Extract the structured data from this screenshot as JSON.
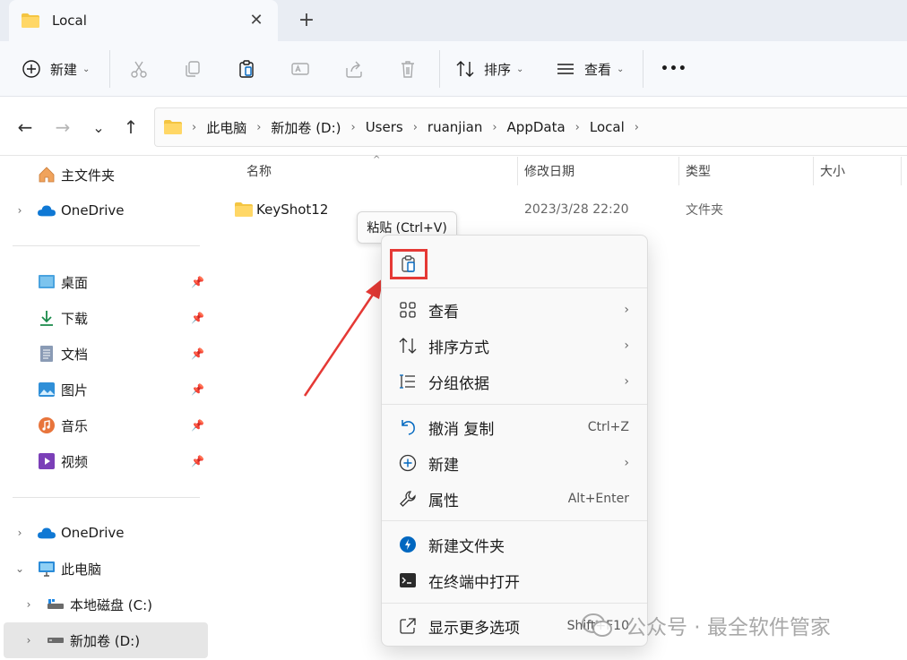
{
  "tab": {
    "title": "Local",
    "close": "✕",
    "new_tab": "+"
  },
  "toolbar": {
    "new_label": "新建",
    "sort_label": "排序",
    "view_label": "查看",
    "more": "•••"
  },
  "breadcrumb": [
    "此电脑",
    "新加卷 (D:)",
    "Users",
    "ruanjian",
    "AppData",
    "Local"
  ],
  "sidebar": {
    "home": "主文件夹",
    "onedrive_top": "OneDrive",
    "quick": [
      {
        "label": "桌面",
        "icon": "desktop-icon"
      },
      {
        "label": "下载",
        "icon": "download-icon"
      },
      {
        "label": "文档",
        "icon": "document-icon"
      },
      {
        "label": "图片",
        "icon": "pictures-icon"
      },
      {
        "label": "音乐",
        "icon": "music-icon"
      },
      {
        "label": "视频",
        "icon": "video-icon"
      }
    ],
    "onedrive": "OneDrive",
    "this_pc": "此电脑",
    "drive_c": "本地磁盘 (C:)",
    "drive_d": "新加卷 (D:)"
  },
  "columns": {
    "name": "名称",
    "date": "修改日期",
    "type": "类型",
    "size": "大小"
  },
  "files": [
    {
      "name": "KeyShot12",
      "date": "2023/3/28 22:20",
      "type": "文件夹"
    }
  ],
  "tooltip": "粘贴 (Ctrl+V)",
  "context_menu": {
    "view": "查看",
    "sort": "排序方式",
    "group": "分组依据",
    "undo": "撤消 复制",
    "undo_shortcut": "Ctrl+Z",
    "new": "新建",
    "properties": "属性",
    "properties_shortcut": "Alt+Enter",
    "new_folder": "新建文件夹",
    "terminal": "在终端中打开",
    "more_options": "显示更多选项",
    "more_shortcut": "Shift+F10"
  },
  "watermark": "公众号 · 最全软件管家",
  "colors": {
    "accent": "#0067c0",
    "highlight_box": "#e53935",
    "folder": "#f4c542"
  }
}
